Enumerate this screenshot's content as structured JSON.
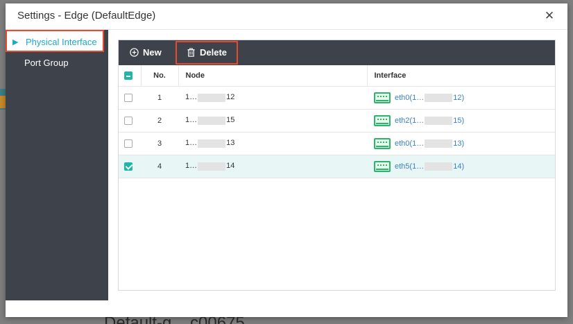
{
  "background": {
    "caption": "Default-g... c00675"
  },
  "dialog": {
    "title": "Settings - Edge (DefaultEdge)",
    "close_icon": "close-icon"
  },
  "sidebar": {
    "items": [
      {
        "label": "Physical Interface",
        "active": true
      },
      {
        "label": "Port Group",
        "active": false
      }
    ]
  },
  "toolbar": {
    "new_label": "New",
    "delete_label": "Delete"
  },
  "table": {
    "headers": {
      "no": "No.",
      "node": "Node",
      "interface": "Interface"
    },
    "rows": [
      {
        "no": "1",
        "node_prefix": "1…",
        "node_suffix": "12",
        "iface_prefix": "eth0(1…",
        "iface_suffix": "12)",
        "checked": false
      },
      {
        "no": "2",
        "node_prefix": "1…",
        "node_suffix": "15",
        "iface_prefix": "eth2(1…",
        "iface_suffix": "15)",
        "checked": false
      },
      {
        "no": "3",
        "node_prefix": "1…",
        "node_suffix": "13",
        "iface_prefix": "eth0(1…",
        "iface_suffix": "13)",
        "checked": false
      },
      {
        "no": "4",
        "node_prefix": "1…",
        "node_suffix": "14",
        "iface_prefix": "eth5(1…",
        "iface_suffix": "14)",
        "checked": true
      }
    ]
  },
  "colors": {
    "accent": "#1aa9c7",
    "highlight_border": "#e8492f",
    "sidebar_bg": "#3e434b",
    "check": "#1fb5a7"
  }
}
